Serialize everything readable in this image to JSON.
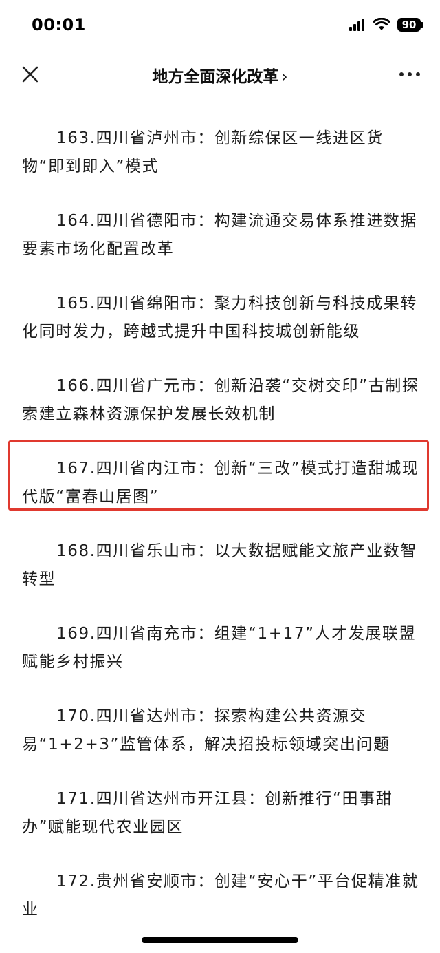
{
  "status_bar": {
    "time": "00:01",
    "battery": "90",
    "icons": [
      "signal-icon",
      "wifi-icon",
      "battery-icon"
    ]
  },
  "nav": {
    "title": "地方全面深化改革",
    "chevron": "›",
    "close_icon": "close-icon",
    "more_icon": "more-icon"
  },
  "colors": {
    "highlight_border": "#e0392f",
    "text": "#1d1d1d",
    "background": "#ffffff"
  },
  "articles": [
    {
      "text": "163.四川省泸州市：创新综保区一线进区货物“即到即入”模式"
    },
    {
      "text": "164.四川省德阳市：构建流通交易体系推进数据要素市场化配置改革"
    },
    {
      "text": "165.四川省绵阳市：聚力科技创新与科技成果转化同时发力，跨越式提升中国科技城创新能级"
    },
    {
      "text": "166.四川省广元市：创新沿袭“交树交印”古制探索建立森林资源保护发展长效机制"
    },
    {
      "text": "167.四川省内江市：创新“三改”模式打造甜城现代版“富春山居图”",
      "highlighted": true
    },
    {
      "text": "168.四川省乐山市：以大数据赋能文旅产业数智转型"
    },
    {
      "text": "169.四川省南充市：组建“1+17”人才发展联盟赋能乡村振兴"
    },
    {
      "text": "170.四川省达州市：探索构建公共资源交易“1+2+3”监管体系，解决招投标领域突出问题"
    },
    {
      "text": "171.四川省达州市开江县：创新推行“田事甜办”赋能现代农业园区"
    },
    {
      "text": "172.贵州省安顺市：创建“安心干”平台促精准就业"
    }
  ]
}
